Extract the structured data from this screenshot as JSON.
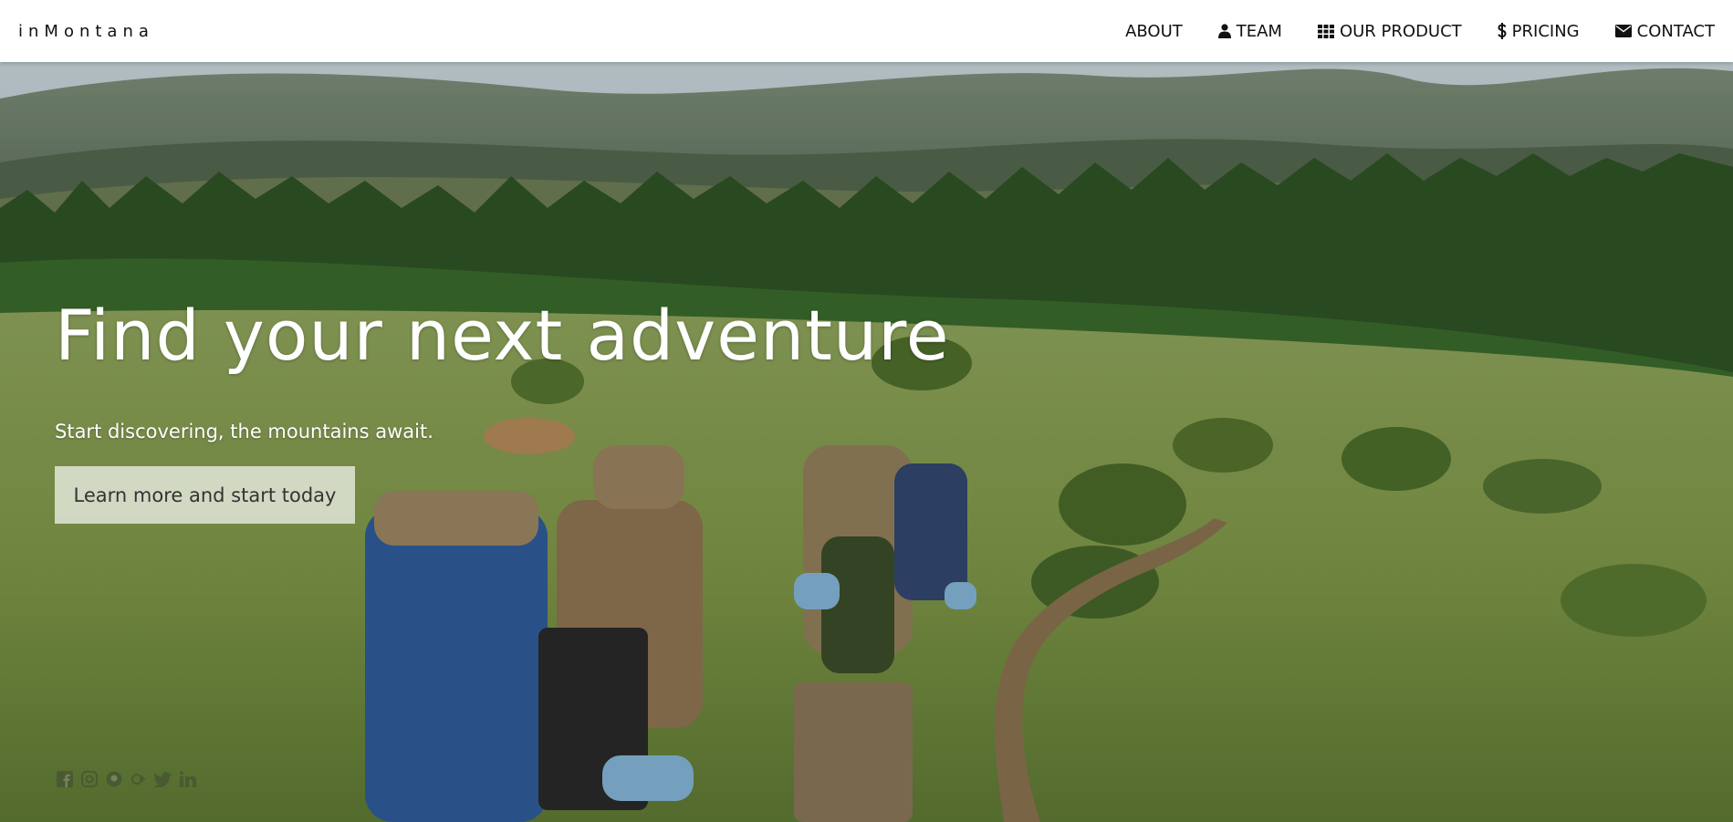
{
  "brand": {
    "name": "inMontana"
  },
  "nav": {
    "items": [
      {
        "label": "ABOUT",
        "icon": ""
      },
      {
        "label": "TEAM",
        "icon": "user-icon"
      },
      {
        "label": "OUR PRODUCT",
        "icon": "grid-icon"
      },
      {
        "label": "PRICING",
        "icon": "dollar-icon"
      },
      {
        "label": "CONTACT",
        "icon": "envelope-icon"
      }
    ]
  },
  "hero": {
    "title": "Find your next adventure",
    "subtitle": "Start discovering, the mountains await.",
    "cta_label": "Learn more and start today",
    "image": "hikers-with-backpacks-on-mountain-meadow-trail"
  },
  "social": {
    "icons": [
      "facebook-icon",
      "instagram-icon",
      "github-icon",
      "google-plus-icon",
      "twitter-icon",
      "linkedin-icon"
    ]
  }
}
